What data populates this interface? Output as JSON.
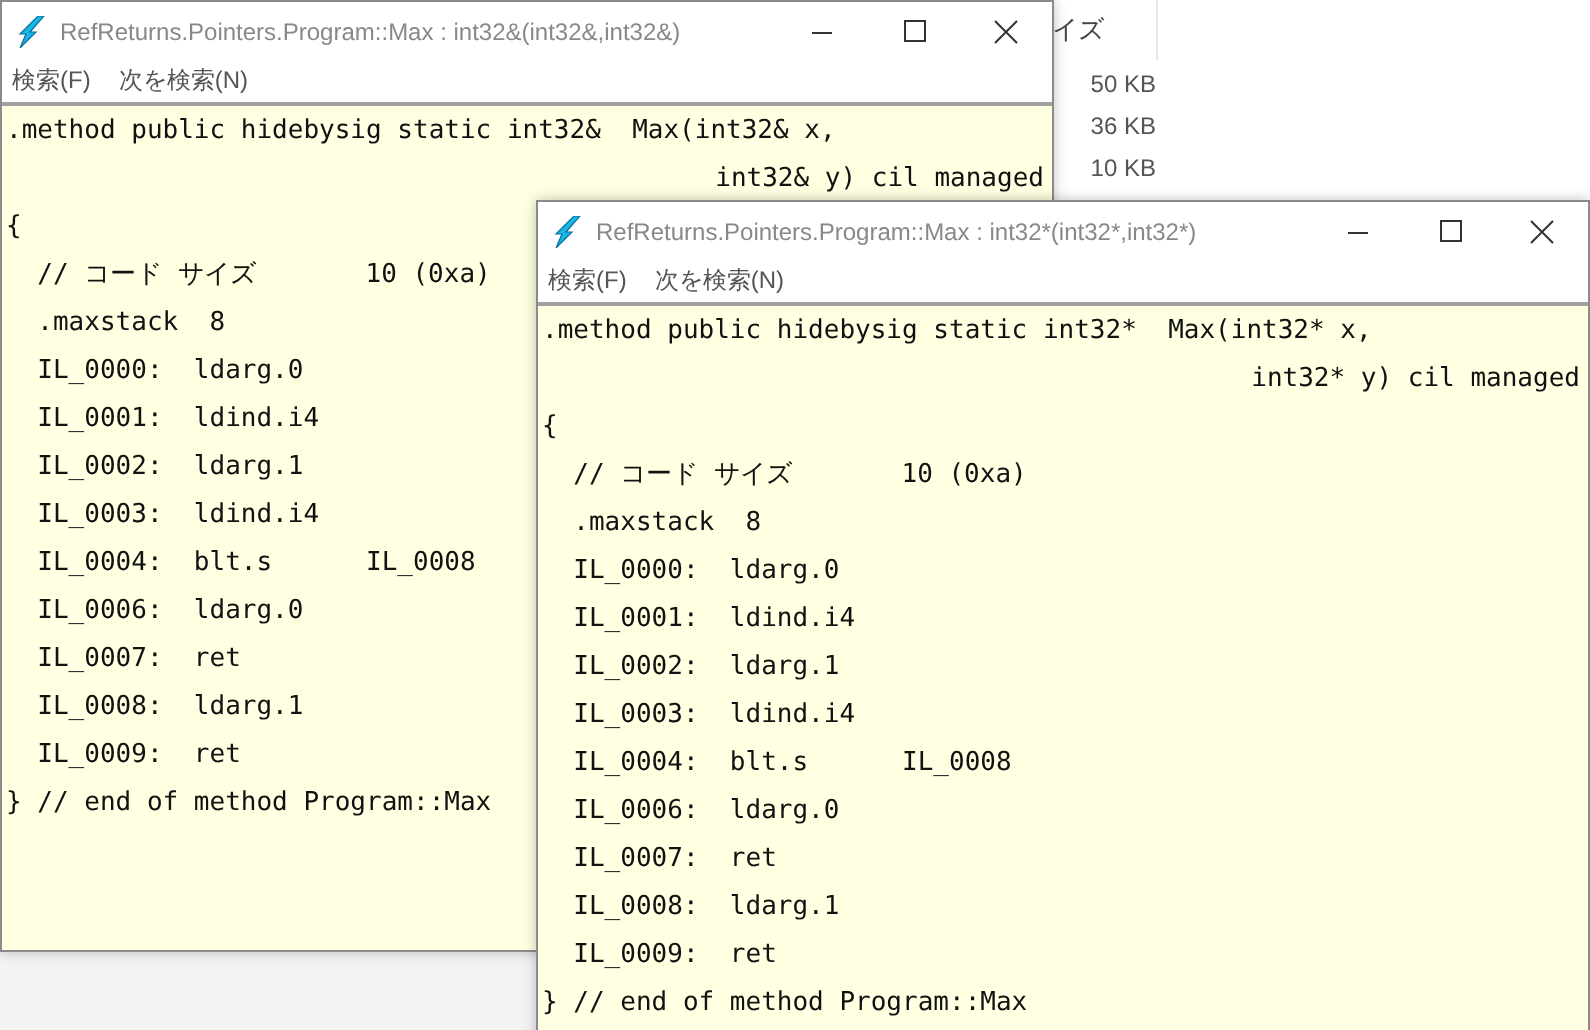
{
  "background_window": {
    "column_header": "イズ",
    "sizes": [
      "50 KB",
      "36 KB",
      "10 KB"
    ]
  },
  "windows": [
    {
      "title": "RefReturns.Pointers.Program::Max : int32&(int32&,int32&)",
      "menu": [
        "検索(F)",
        "次を検索(N)"
      ],
      "lines": [
        {
          "kind": "line",
          "text": ".method public hidebysig static int32&  Max(int32& x,"
        },
        {
          "kind": "continuation",
          "text": "int32& y) cil managed"
        },
        {
          "kind": "line",
          "text": "{"
        },
        {
          "kind": "line",
          "text": "  // コード サイズ       10 (0xa)"
        },
        {
          "kind": "line",
          "text": "  .maxstack  8"
        },
        {
          "kind": "line",
          "text": "  IL_0000:  ldarg.0"
        },
        {
          "kind": "line",
          "text": "  IL_0001:  ldind.i4"
        },
        {
          "kind": "line",
          "text": "  IL_0002:  ldarg.1"
        },
        {
          "kind": "line",
          "text": "  IL_0003:  ldind.i4"
        },
        {
          "kind": "line",
          "text": "  IL_0004:  blt.s      IL_0008"
        },
        {
          "kind": "line",
          "text": "  IL_0006:  ldarg.0"
        },
        {
          "kind": "line",
          "text": "  IL_0007:  ret"
        },
        {
          "kind": "line",
          "text": "  IL_0008:  ldarg.1"
        },
        {
          "kind": "line",
          "text": "  IL_0009:  ret"
        },
        {
          "kind": "line",
          "text": "} // end of method Program::Max"
        }
      ]
    },
    {
      "title": "RefReturns.Pointers.Program::Max : int32*(int32*,int32*)",
      "menu": [
        "検索(F)",
        "次を検索(N)"
      ],
      "lines": [
        {
          "kind": "line",
          "text": ".method public hidebysig static int32*  Max(int32* x,"
        },
        {
          "kind": "continuation",
          "text": "int32* y) cil managed"
        },
        {
          "kind": "line",
          "text": "{"
        },
        {
          "kind": "line",
          "text": "  // コード サイズ       10 (0xa)"
        },
        {
          "kind": "line",
          "text": "  .maxstack  8"
        },
        {
          "kind": "line",
          "text": "  IL_0000:  ldarg.0"
        },
        {
          "kind": "line",
          "text": "  IL_0001:  ldind.i4"
        },
        {
          "kind": "line",
          "text": "  IL_0002:  ldarg.1"
        },
        {
          "kind": "line",
          "text": "  IL_0003:  ldind.i4"
        },
        {
          "kind": "line",
          "text": "  IL_0004:  blt.s      IL_0008"
        },
        {
          "kind": "line",
          "text": "  IL_0006:  ldarg.0"
        },
        {
          "kind": "line",
          "text": "  IL_0007:  ret"
        },
        {
          "kind": "line",
          "text": "  IL_0008:  ldarg.1"
        },
        {
          "kind": "line",
          "text": "  IL_0009:  ret"
        },
        {
          "kind": "line",
          "text": "} // end of method Program::Max"
        }
      ]
    }
  ]
}
